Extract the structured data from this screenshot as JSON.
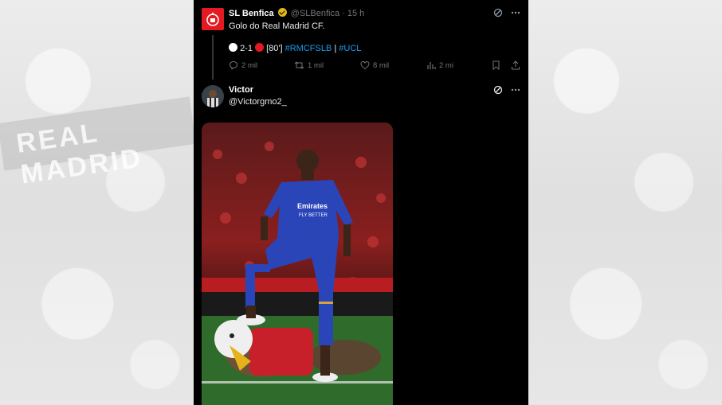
{
  "tweet1": {
    "name": "SL Benfica",
    "handle": "@SLBenfica",
    "time": "15 h",
    "text": "Golo do Real Madrid CF.",
    "score_a": "2-1",
    "minute": "[80']",
    "hashtag1": "#RMCFSLB",
    "separator": "|",
    "hashtag2": "#UCL",
    "replies": "2 mil",
    "retweets": "1 mil",
    "likes": "8 mil",
    "views": "2 mi"
  },
  "tweet2": {
    "name": "Victor",
    "handle": "@Victorgmo2_"
  },
  "media": {
    "shirt_sponsor_line1": "Emirates",
    "shirt_sponsor_line2": "FLY BETTER"
  },
  "background": {
    "scarf_text": "REAL MADRID"
  },
  "colors": {
    "panel_bg": "#000000",
    "link": "#1d9bf0",
    "benfica_red": "#e31a22",
    "verified_gold": "#e2b719"
  },
  "icons": {
    "reply": "reply-icon",
    "retweet": "retweet-icon",
    "like": "heart-icon",
    "views": "views-icon",
    "bookmark": "bookmark-icon",
    "share": "share-icon",
    "grok": "grok-icon",
    "more": "more-icon"
  }
}
